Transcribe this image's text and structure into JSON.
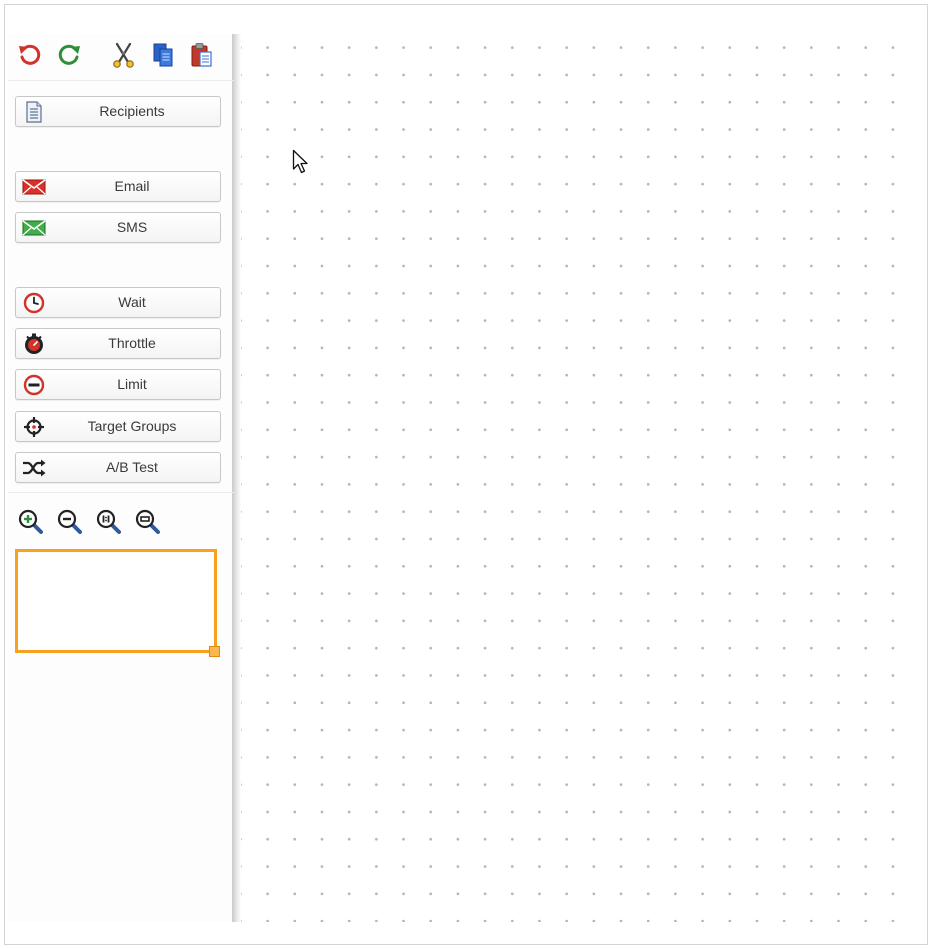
{
  "toolbar": {
    "buttons": [
      {
        "name": "undo",
        "icon": "undo-icon",
        "color": "#d0332a"
      },
      {
        "name": "redo",
        "icon": "redo-icon",
        "color": "#2f8e3a"
      },
      {
        "name": "cut",
        "icon": "scissors-icon"
      },
      {
        "name": "copy",
        "icon": "copy-icon",
        "color": "#2a63c4"
      },
      {
        "name": "paste",
        "icon": "paste-icon",
        "color": "#c0392b"
      }
    ]
  },
  "palette": {
    "groups": [
      {
        "items": [
          {
            "label": "Recipients",
            "icon": "document-list-icon"
          }
        ]
      },
      {
        "items": [
          {
            "label": "Email",
            "icon": "email-envelope-icon",
            "color": "#d9302a"
          },
          {
            "label": "SMS",
            "icon": "sms-envelope-icon",
            "color": "#3fae48"
          }
        ]
      },
      {
        "items": [
          {
            "label": "Wait",
            "icon": "clock-icon",
            "color": "#d0332a"
          },
          {
            "label": "Throttle",
            "icon": "stopwatch-icon",
            "color": "#d0332a"
          },
          {
            "label": "Limit",
            "icon": "no-entry-icon",
            "color": "#d0332a"
          },
          {
            "label": "Target Groups",
            "icon": "crosshair-icon"
          },
          {
            "label": "A/B Test",
            "icon": "shuffle-icon"
          }
        ]
      }
    ]
  },
  "zoom": {
    "buttons": [
      {
        "name": "zoom-in",
        "icon": "zoom-in-icon"
      },
      {
        "name": "zoom-out",
        "icon": "zoom-out-icon"
      },
      {
        "name": "zoom-actual",
        "icon": "zoom-actual-icon"
      },
      {
        "name": "zoom-fit",
        "icon": "zoom-fit-icon"
      }
    ]
  },
  "outline": {
    "color": "#f7a21e"
  },
  "canvas": {
    "grid": "dotted"
  }
}
